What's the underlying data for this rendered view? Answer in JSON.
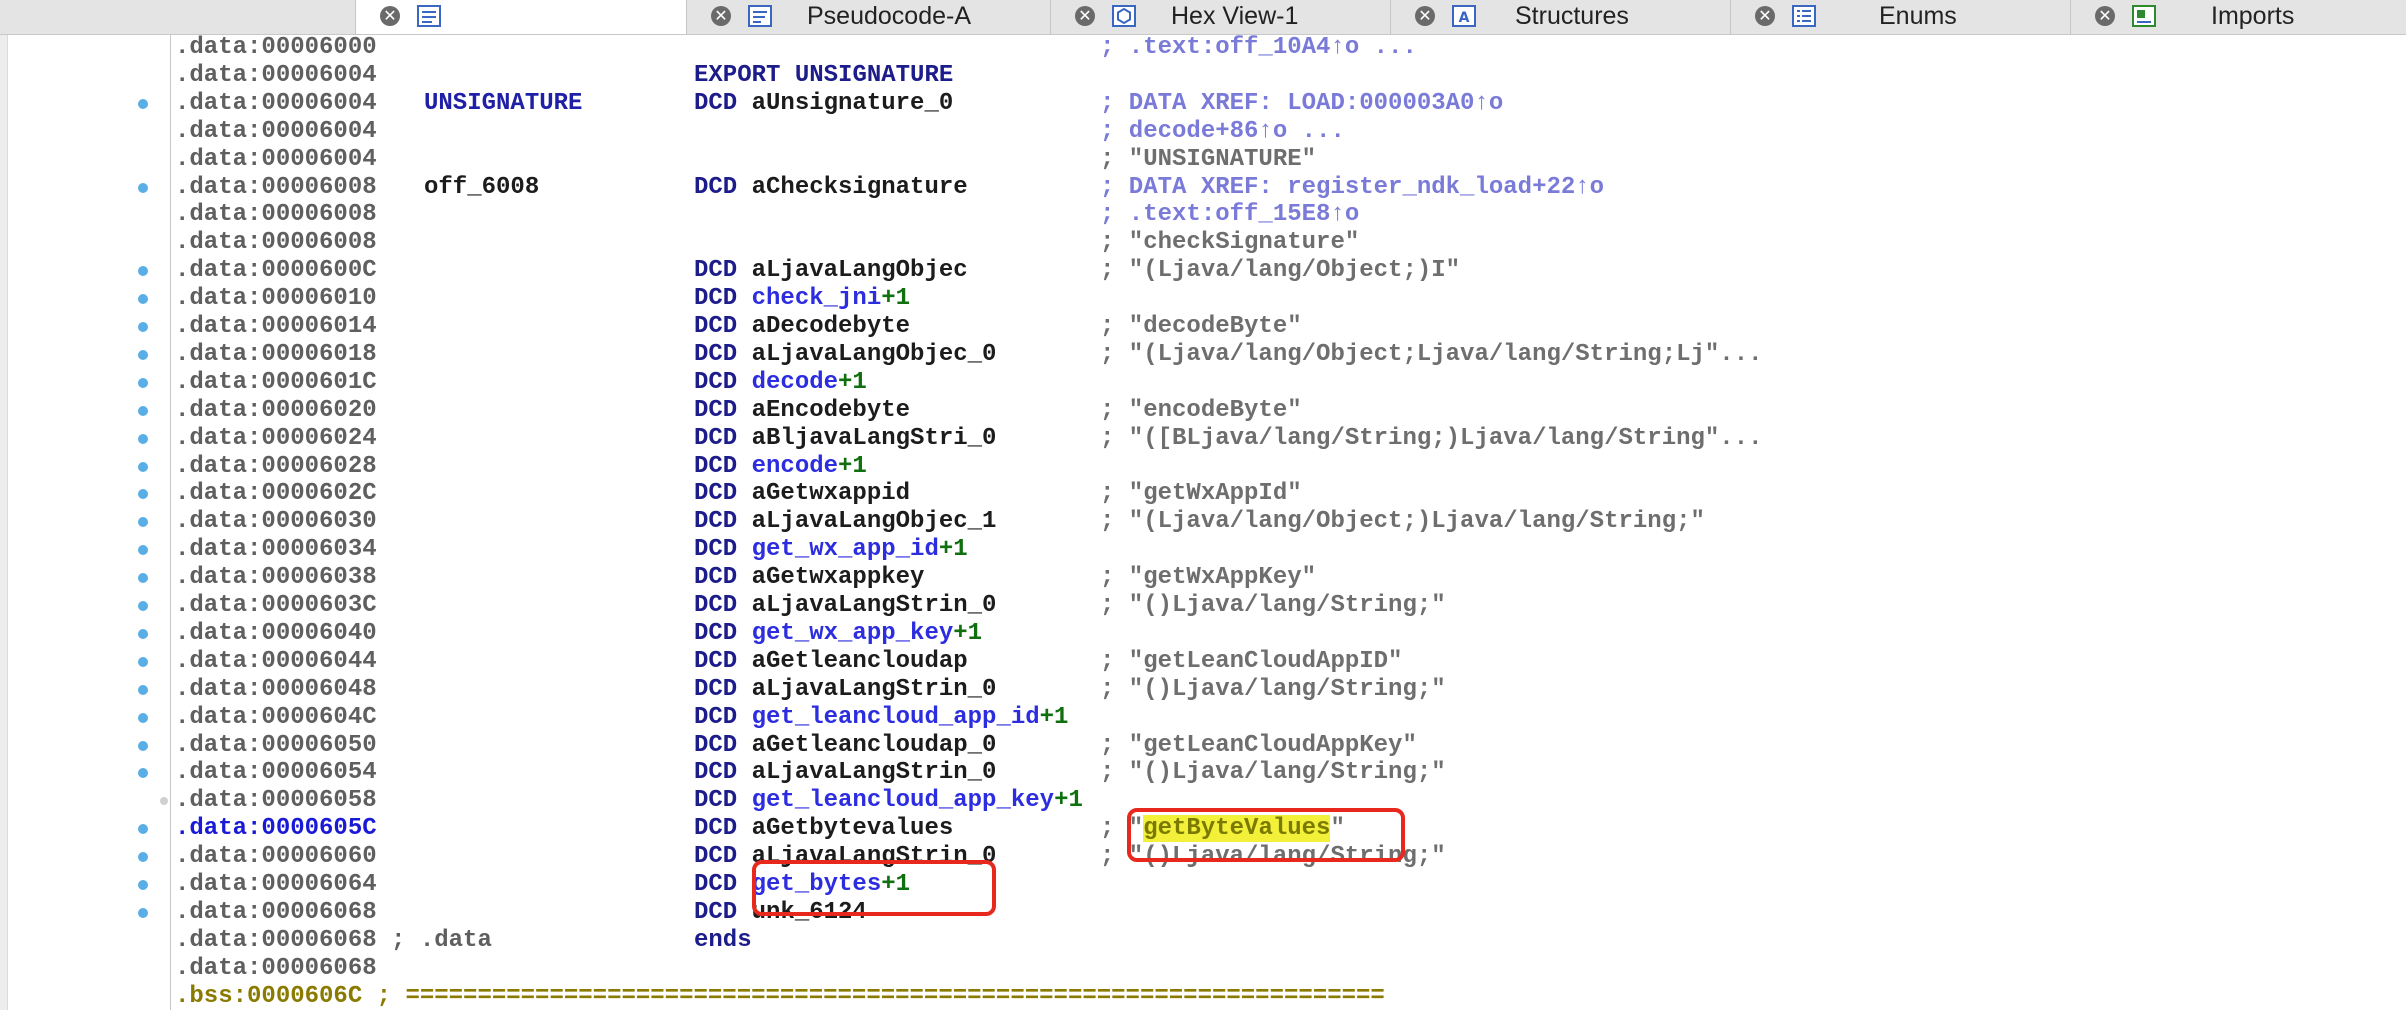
{
  "tabs": [
    {
      "label": "",
      "icon": "ida-view-icon",
      "active": true
    },
    {
      "label": "Pseudocode-A",
      "icon": "pseudocode-icon",
      "active": false
    },
    {
      "label": "Hex View-1",
      "icon": "hex-view-icon",
      "active": false
    },
    {
      "label": "Structures",
      "icon": "structures-icon",
      "active": false
    },
    {
      "label": "Enums",
      "icon": "enums-icon",
      "active": false
    },
    {
      "label": "Imports",
      "icon": "imports-icon",
      "active": false
    }
  ],
  "close_glyph": "✕",
  "lines": [
    {
      "addr": ".data:00006000",
      "label": "",
      "op": "",
      "arg": "",
      "suffix": "",
      "comment": "; .text:off_10A4↑o ...",
      "comment_type": "xref"
    },
    {
      "addr": ".data:00006004",
      "label": "",
      "op": "EXPORT ",
      "arg": "UNSIGNATURE",
      "suffix": "",
      "comment": "",
      "comment_type": ""
    },
    {
      "addr": ".data:00006004",
      "label": "UNSIGNATURE",
      "op": "DCD ",
      "arg": "aUnsignature_0",
      "suffix": "",
      "comment": "; DATA XREF: LOAD:000003A0↑o",
      "comment_type": "xref"
    },
    {
      "addr": ".data:00006004",
      "label": "",
      "op": "",
      "arg": "",
      "suffix": "",
      "comment": "; decode+86↑o ...",
      "comment_type": "xref"
    },
    {
      "addr": ".data:00006004",
      "label": "",
      "op": "",
      "arg": "",
      "suffix": "",
      "comment": "; \"UNSIGNATURE\"",
      "comment_type": "str"
    },
    {
      "addr": ".data:00006008",
      "label": "off_6008",
      "op": "DCD ",
      "arg": "aChecksignature",
      "suffix": "",
      "comment": "; DATA XREF: register_ndk_load+22↑o",
      "comment_type": "xref"
    },
    {
      "addr": ".data:00006008",
      "label": "",
      "op": "",
      "arg": "",
      "suffix": "",
      "comment": "; .text:off_15E8↑o",
      "comment_type": "xref"
    },
    {
      "addr": ".data:00006008",
      "label": "",
      "op": "",
      "arg": "",
      "suffix": "",
      "comment": "; \"checkSignature\"",
      "comment_type": "str"
    },
    {
      "addr": ".data:0000600C",
      "label": "",
      "op": "DCD ",
      "arg": "aLjavaLangObjec",
      "suffix": "",
      "comment": "; \"(Ljava/lang/Object;)I\"",
      "comment_type": "str"
    },
    {
      "addr": ".data:00006010",
      "label": "",
      "op": "DCD ",
      "arg": "check_jni",
      "suffix": "+1",
      "comment": "",
      "comment_type": ""
    },
    {
      "addr": ".data:00006014",
      "label": "",
      "op": "DCD ",
      "arg": "aDecodebyte",
      "suffix": "",
      "comment": "; \"decodeByte\"",
      "comment_type": "str"
    },
    {
      "addr": ".data:00006018",
      "label": "",
      "op": "DCD ",
      "arg": "aLjavaLangObjec_0",
      "suffix": "",
      "comment": "; \"(Ljava/lang/Object;Ljava/lang/String;Lj\"...",
      "comment_type": "str"
    },
    {
      "addr": ".data:0000601C",
      "label": "",
      "op": "DCD ",
      "arg": "decode",
      "suffix": "+1",
      "comment": "",
      "comment_type": ""
    },
    {
      "addr": ".data:00006020",
      "label": "",
      "op": "DCD ",
      "arg": "aEncodebyte",
      "suffix": "",
      "comment": "; \"encodeByte\"",
      "comment_type": "str"
    },
    {
      "addr": ".data:00006024",
      "label": "",
      "op": "DCD ",
      "arg": "aBljavaLangStri_0",
      "suffix": "",
      "comment": "; \"([BLjava/lang/String;)Ljava/lang/String\"...",
      "comment_type": "str"
    },
    {
      "addr": ".data:00006028",
      "label": "",
      "op": "DCD ",
      "arg": "encode",
      "suffix": "+1",
      "comment": "",
      "comment_type": ""
    },
    {
      "addr": ".data:0000602C",
      "label": "",
      "op": "DCD ",
      "arg": "aGetwxappid",
      "suffix": "",
      "comment": "; \"getWxAppId\"",
      "comment_type": "str"
    },
    {
      "addr": ".data:00006030",
      "label": "",
      "op": "DCD ",
      "arg": "aLjavaLangObjec_1",
      "suffix": "",
      "comment": "; \"(Ljava/lang/Object;)Ljava/lang/String;\"",
      "comment_type": "str"
    },
    {
      "addr": ".data:00006034",
      "label": "",
      "op": "DCD ",
      "arg": "get_wx_app_id",
      "suffix": "+1",
      "comment": "",
      "comment_type": ""
    },
    {
      "addr": ".data:00006038",
      "label": "",
      "op": "DCD ",
      "arg": "aGetwxappkey",
      "suffix": "",
      "comment": "; \"getWxAppKey\"",
      "comment_type": "str"
    },
    {
      "addr": ".data:0000603C",
      "label": "",
      "op": "DCD ",
      "arg": "aLjavaLangStrin_0",
      "suffix": "",
      "comment": "; \"()Ljava/lang/String;\"",
      "comment_type": "str"
    },
    {
      "addr": ".data:00006040",
      "label": "",
      "op": "DCD ",
      "arg": "get_wx_app_key",
      "suffix": "+1",
      "comment": "",
      "comment_type": ""
    },
    {
      "addr": ".data:00006044",
      "label": "",
      "op": "DCD ",
      "arg": "aGetleancloudap",
      "suffix": "",
      "comment": "; \"getLeanCloudAppID\"",
      "comment_type": "str"
    },
    {
      "addr": ".data:00006048",
      "label": "",
      "op": "DCD ",
      "arg": "aLjavaLangStrin_0",
      "suffix": "",
      "comment": "; \"()Ljava/lang/String;\"",
      "comment_type": "str"
    },
    {
      "addr": ".data:0000604C",
      "label": "",
      "op": "DCD ",
      "arg": "get_leancloud_app_id",
      "suffix": "+1",
      "comment": "",
      "comment_type": ""
    },
    {
      "addr": ".data:00006050",
      "label": "",
      "op": "DCD ",
      "arg": "aGetleancloudap_0",
      "suffix": "",
      "comment": "; \"getLeanCloudAppKey\"",
      "comment_type": "str"
    },
    {
      "addr": ".data:00006054",
      "label": "",
      "op": "DCD ",
      "arg": "aLjavaLangStrin_0",
      "suffix": "",
      "comment": "; \"()Ljava/lang/String;\"",
      "comment_type": "str"
    },
    {
      "addr": ".data:00006058",
      "label": "",
      "op": "DCD ",
      "arg": "get_leancloud_app_key",
      "suffix": "+1",
      "comment": "",
      "comment_type": ""
    },
    {
      "addr": ".data:0000605C",
      "label": "",
      "op": "DCD ",
      "arg": "aGetbytevalues",
      "suffix": "",
      "comment": "; \"getByteValues\"",
      "comment_type": "str-hl",
      "highlight": "getByteValues"
    },
    {
      "addr": ".data:00006060",
      "label": "",
      "op": "DCD ",
      "arg": "aLjavaLangStrin_0",
      "suffix": "",
      "comment": "; \"()Ljava/lang/String;\"",
      "comment_type": "str"
    },
    {
      "addr": ".data:00006064",
      "label": "",
      "op": "DCD ",
      "arg": "get_bytes",
      "suffix": "+1",
      "comment": "",
      "comment_type": ""
    },
    {
      "addr": ".data:00006068",
      "label": "",
      "op": "DCD ",
      "arg": "unk_6124",
      "suffix": "",
      "comment": "",
      "comment_type": ""
    },
    {
      "addr": ".data:00006068 ; .data",
      "label": "",
      "op": "ends",
      "arg": "",
      "suffix": "",
      "comment": "",
      "comment_type": ""
    },
    {
      "addr": ".data:00006068",
      "label": "",
      "op": "",
      "arg": "",
      "suffix": "",
      "comment": "",
      "comment_type": ""
    },
    {
      "addr": ".bss:0000606C ; ====================================================================",
      "label": "",
      "op": "",
      "arg": "",
      "suffix": "",
      "comment": "",
      "comment_type": "bss"
    }
  ],
  "dot_lines": [
    2,
    5,
    8,
    9,
    10,
    11,
    12,
    13,
    14,
    15,
    16,
    17,
    18,
    19,
    20,
    21,
    22,
    23,
    24,
    25,
    26,
    28,
    29,
    30,
    31
  ],
  "small_dot_lines": [
    27
  ],
  "selected_line": 28,
  "colors": {
    "annotation_red": "#e8281c",
    "highlight_yellow": "#f3f03a",
    "dot_blue": "#5aaee6"
  }
}
